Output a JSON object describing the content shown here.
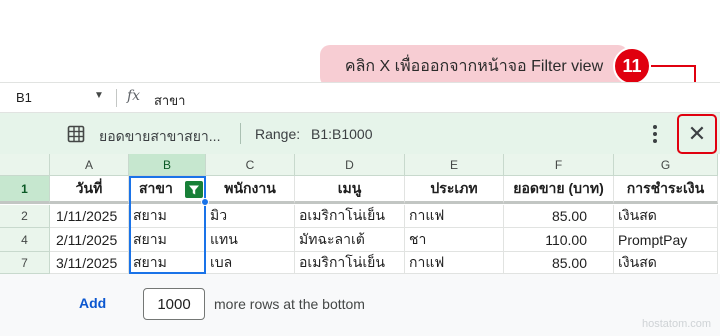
{
  "callout": {
    "text": "คลิก X เพื่อออกจากหน้าจอ Filter view",
    "step": "11"
  },
  "formula_bar": {
    "cell_ref": "B1",
    "fx": "fx",
    "value": "สาขา"
  },
  "filter_view": {
    "name": "ยอดขายสาขาสยา...",
    "range_label": "Range:",
    "range_value": "B1:B1000",
    "close_symbol": "✕"
  },
  "columns": [
    "A",
    "B",
    "C",
    "D",
    "E",
    "F",
    "G"
  ],
  "header_row": {
    "row_number": "1",
    "cells": [
      "วันที่",
      "สาขา",
      "พนักงาน",
      "เมนู",
      "ประเภท",
      "ยอดขาย (บาท)",
      "การชำระเงิน"
    ]
  },
  "rows": [
    {
      "row_number": "2",
      "cells": [
        "1/11/2025",
        "สยาม",
        "มิว",
        "อเมริกาโน่เย็น",
        "กาแฟ",
        "85.00",
        "เงินสด"
      ]
    },
    {
      "row_number": "4",
      "cells": [
        "2/11/2025",
        "สยาม",
        "แทน",
        "มัทฉะลาเต้",
        "ชา",
        "110.00",
        "PromptPay"
      ]
    },
    {
      "row_number": "7",
      "cells": [
        "3/11/2025",
        "สยาม",
        "เบล",
        "อเมริกาโน่เย็น",
        "กาแฟ",
        "85.00",
        "เงินสด"
      ]
    }
  ],
  "footer": {
    "add_label": "Add",
    "rows_value": "1000",
    "suffix": "more rows at the bottom"
  },
  "watermark": "hostatom.com",
  "icons": {
    "sheet": "sheet-grid-icon",
    "more": "more-vert-icon",
    "filter": "filter-icon",
    "close": "close-icon",
    "dropdown": "chevron-down-icon"
  },
  "colors": {
    "accent_red": "#e0000f",
    "filter_green": "#188038",
    "selection_blue": "#1a73e8",
    "callout_pink": "#f7cdd3"
  }
}
